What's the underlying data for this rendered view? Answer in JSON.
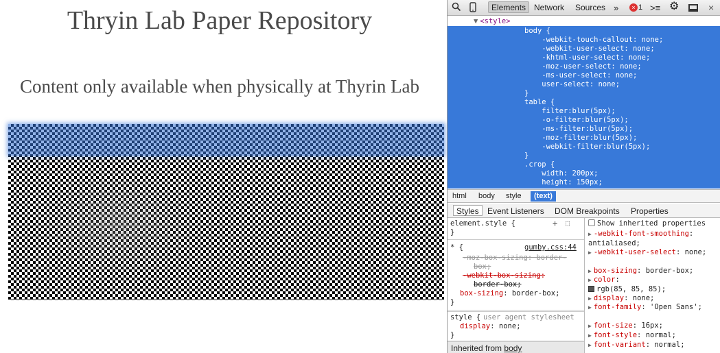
{
  "page": {
    "title": "Thryin Lab Paper Repository",
    "subtitle": "Content only available when physically at Thyrin Lab"
  },
  "devtools": {
    "toolbar": {
      "tabs": [
        "Elements",
        "Network",
        "Sources"
      ],
      "more": "»",
      "error_count": "1",
      "close": "×"
    },
    "elements_tree": {
      "node": "<style>",
      "css_text": "body {\n    -webkit-touch-callout: none;\n    -webkit-user-select: none;\n    -khtml-user-select: none;\n    -moz-user-select: none;\n    -ms-user-select: none;\n    user-select: none;\n}\ntable {\n    filter:blur(5px);\n    -o-filter:blur(5px);\n    -ms-filter:blur(5px);\n    -moz-filter:blur(5px);\n    -webkit-filter:blur(5px);\n}\n.crop {\n    width: 200px;\n    height: 150px;"
    },
    "breadcrumb": [
      "html",
      "body",
      "style",
      "(text)"
    ],
    "subtabs": [
      "Styles",
      "Event Listeners",
      "DOM Breakpoints",
      "Properties"
    ],
    "styles": {
      "element_style_selector": "element.style {",
      "element_style_close": "}",
      "star_selector": "* {",
      "star_source": "gumby.css:44",
      "star_rules": {
        "moz_box_sizing_prop": "-moz-box-sizing: border-",
        "moz_box_sizing_cont": "box;",
        "webkit_box_sizing_prop": "-webkit-box-sizing:",
        "webkit_box_sizing_val": "border-box;",
        "box_sizing_prop": "box-sizing",
        "box_sizing_val": ": border-box;"
      },
      "star_close": "}",
      "ua_selector": "style {",
      "ua_source": "user agent stylesheet",
      "ua_prop": "display",
      "ua_val": ": none;",
      "ua_close": "}",
      "inherited_label": "Inherited from",
      "inherited_link": "body"
    },
    "computed": {
      "show_inherited_label": "Show inherited properties",
      "properties": [
        {
          "name": "-webkit-font-smoothing",
          "value": "antialiased;"
        },
        {
          "name": "-webkit-user-select",
          "value": "none;"
        },
        {
          "name": "box-sizing",
          "value": "border-box;"
        },
        {
          "name": "color",
          "value": "rgb(85, 85, 85);"
        },
        {
          "name": "display",
          "value": "none;"
        },
        {
          "name": "font-family",
          "value": "'Open Sans';"
        },
        {
          "name": "font-size",
          "value": "16px;"
        },
        {
          "name": "font-style",
          "value": "normal;"
        },
        {
          "name": "font-variant",
          "value": "normal;"
        }
      ]
    }
  },
  "colors": {
    "selection_blue": "#3879d9",
    "text_color_swatch": "#555555",
    "error_red": "#dd3333"
  }
}
